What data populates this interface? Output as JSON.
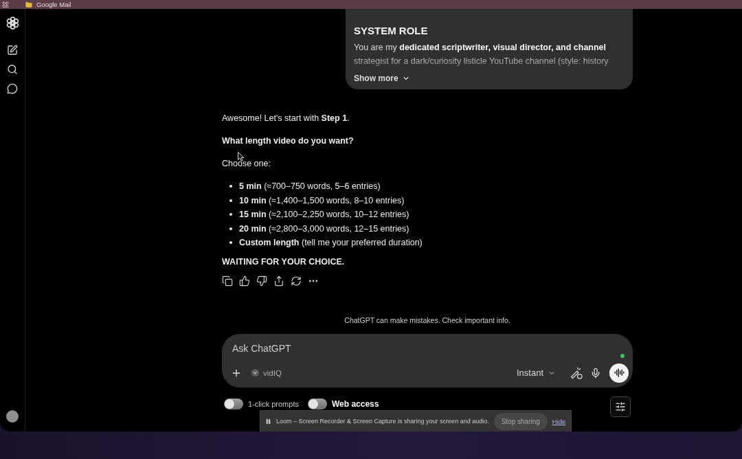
{
  "bookmarks_bar": {
    "items": [
      {
        "label": "Google Mail"
      }
    ]
  },
  "system_role_card": {
    "title": "SYSTEM ROLE",
    "description": [
      "You are my **dedicated scriptwriter, visual director, and channel**",
      "strategist for a dark/curiosity listicle YouTube channel (style: history"
    ],
    "show_more": {
      "label": "Show more",
      "expanded": false
    }
  },
  "assistant_message": {
    "blocks": [
      {
        "kind": "text",
        "text": "Awesome! Let's start with **Step 1**."
      },
      {
        "kind": "strong",
        "text": "What length video do you want?"
      },
      {
        "kind": "text",
        "text": "Choose one:"
      },
      {
        "kind": "list",
        "items": [
          "**5 min** (≈700–750 words, 5–6 entries)",
          "**10 min** (≈1,400–1,500 words, 8–10 entries)",
          "**15 min** (≈2,100–2,250 words, 10–12 entries)",
          "**20 min** (≈2,800–3,000 words, 12–15 entries)",
          "**Custom length** (tell me your preferred duration)"
        ]
      },
      {
        "kind": "strong",
        "text": "WAITING FOR YOUR CHOICE."
      }
    ]
  },
  "disclaimer": "ChatGPT can make mistakes. Check important info.",
  "composer": {
    "placeholder": "Ask ChatGPT",
    "tool_chip": "vidIQ",
    "model": "Instant"
  },
  "extension_bar": {
    "toggles": [
      {
        "label": "1-click prompts",
        "on": false,
        "highlighted": false
      },
      {
        "label": "Web access",
        "on": false,
        "highlighted": true
      }
    ]
  },
  "loom_banner": {
    "message": "Loom – Screen Recorder & Screen Capture is sharing your screen and audio.",
    "stop_button": "Stop sharing",
    "hide_link": "Hide"
  }
}
